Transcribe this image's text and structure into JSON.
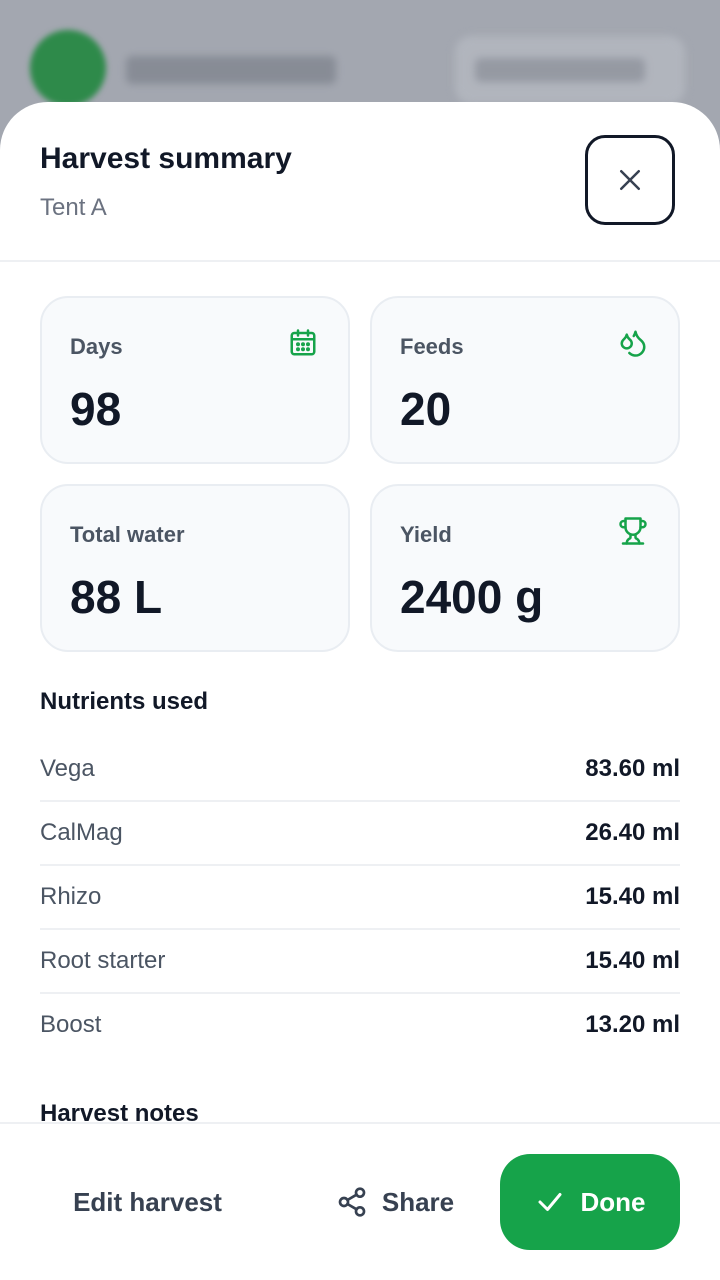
{
  "background": {
    "accent": "#16a34a"
  },
  "sheet": {
    "title": "Harvest summary",
    "subtitle": "Tent A",
    "close_icon": "close-icon"
  },
  "stats": [
    {
      "label": "Days",
      "value": "98",
      "icon": "calendar-icon"
    },
    {
      "label": "Feeds",
      "value": "20",
      "icon": "droplets-icon"
    },
    {
      "label": "Total water",
      "value": "88 L",
      "icon": ""
    },
    {
      "label": "Yield",
      "value": "2400 g",
      "icon": "trophy-icon"
    }
  ],
  "nutrients": {
    "title": "Nutrients used",
    "items": [
      {
        "name": "Vega",
        "amount": "83.60 ml"
      },
      {
        "name": "CalMag",
        "amount": "26.40 ml"
      },
      {
        "name": "Rhizo",
        "amount": "15.40 ml"
      },
      {
        "name": "Root starter",
        "amount": "15.40 ml"
      },
      {
        "name": "Boost",
        "amount": "13.20 ml"
      }
    ]
  },
  "notes": {
    "title": "Harvest notes"
  },
  "footer": {
    "edit_label": "Edit harvest",
    "share_label": "Share",
    "done_label": "Done"
  }
}
